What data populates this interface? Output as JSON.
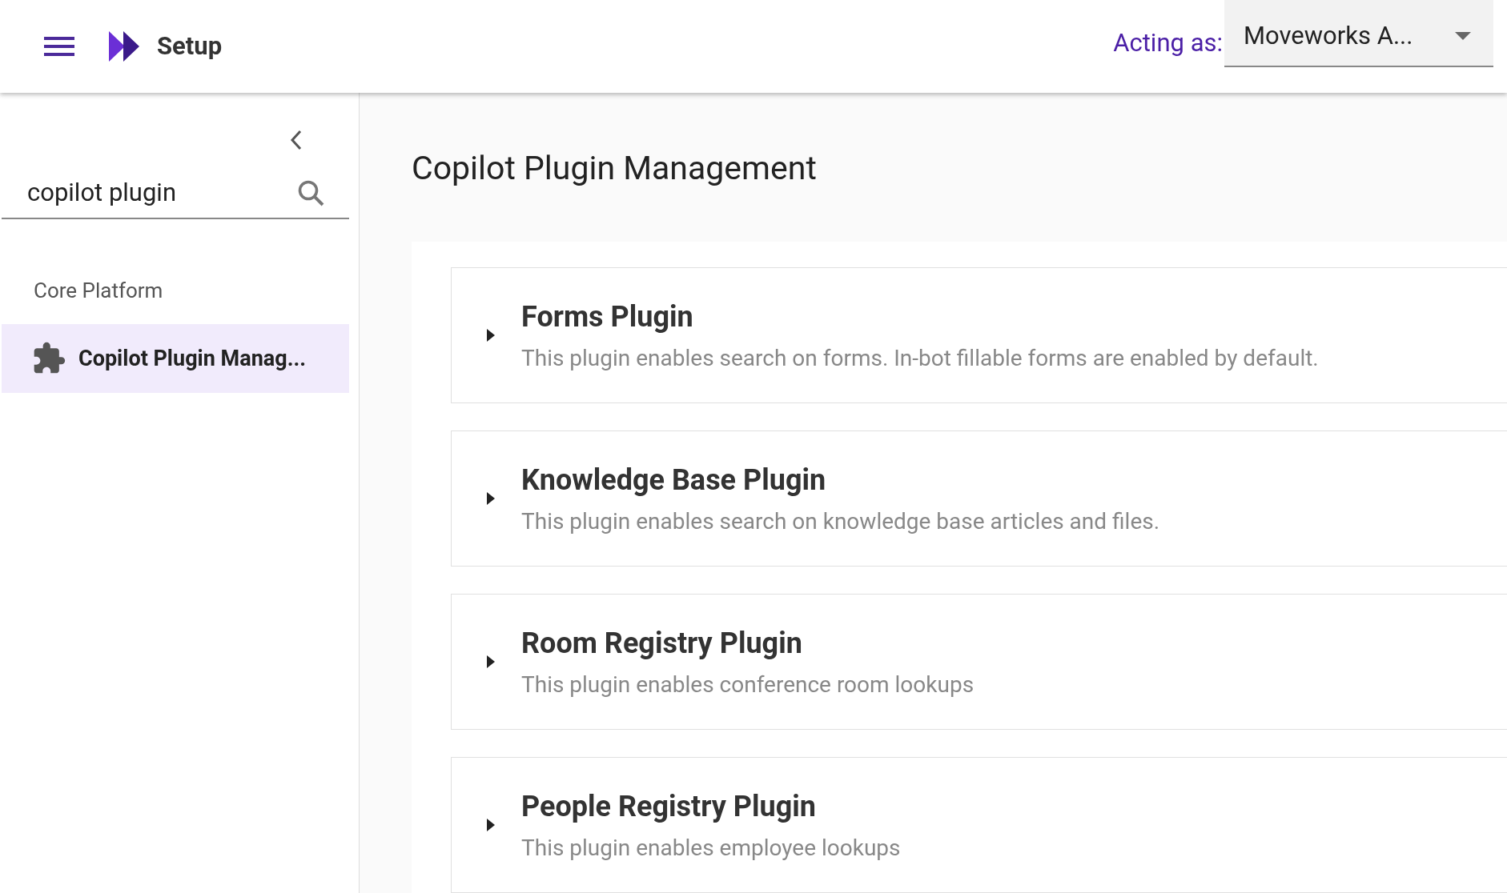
{
  "header": {
    "title": "Setup",
    "acting_as_label": "Acting as:",
    "acting_as_value": "Moveworks A..."
  },
  "sidebar": {
    "search": {
      "value": "copilot plugin"
    },
    "section": "Core Platform",
    "items": [
      {
        "label": "Copilot Plugin Manag...",
        "selected": true
      }
    ]
  },
  "page": {
    "title": "Copilot Plugin Management"
  },
  "plugins": [
    {
      "title": "Forms Plugin",
      "description": "This plugin enables search on forms. In-bot fillable forms are enabled by default.",
      "expanded": false
    },
    {
      "title": "Knowledge Base Plugin",
      "description": "This plugin enables search on knowledge base articles and files.",
      "expanded": false
    },
    {
      "title": "Room Registry Plugin",
      "description": "This plugin enables conference room lookups",
      "expanded": false
    },
    {
      "title": "People Registry Plugin",
      "description": "This plugin enables employee lookups",
      "expanded": false
    }
  ]
}
